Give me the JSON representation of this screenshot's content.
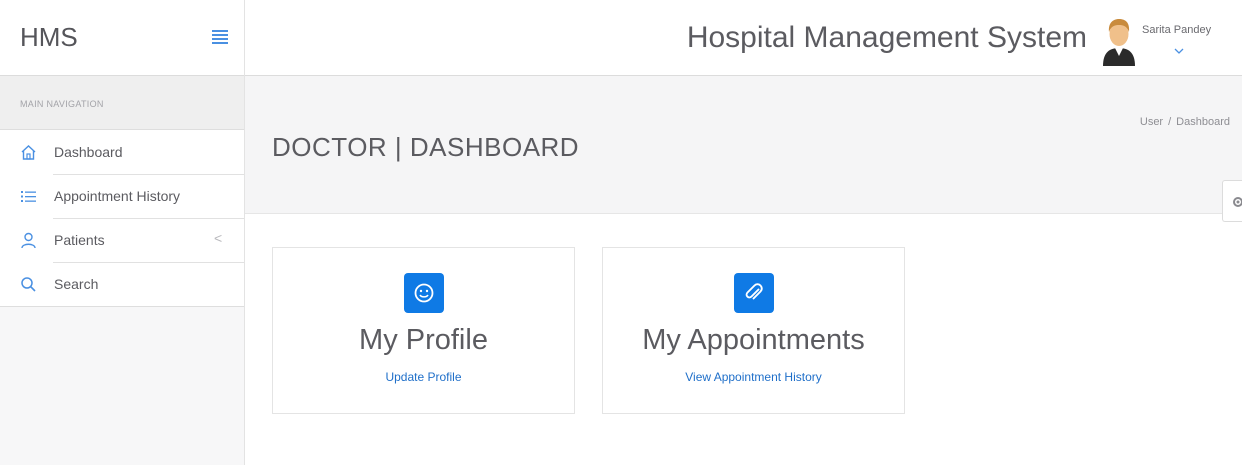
{
  "brand": "HMS",
  "sidebar": {
    "section_label": "MAIN NAVIGATION",
    "items": [
      {
        "label": "Dashboard",
        "icon": "home-icon"
      },
      {
        "label": "Appointment History",
        "icon": "list-icon"
      },
      {
        "label": "Patients",
        "icon": "user-icon",
        "chevron": "<"
      },
      {
        "label": "Search",
        "icon": "search-icon"
      }
    ]
  },
  "header": {
    "title": "Hospital Management System",
    "user_name": "Sarita Pandey"
  },
  "page": {
    "title": "DOCTOR | DASHBOARD",
    "breadcrumb": [
      "User",
      "Dashboard"
    ],
    "breadcrumb_sep": "/"
  },
  "cards": [
    {
      "title": "My Profile",
      "link": "Update Profile",
      "icon": "smiley-icon"
    },
    {
      "title": "My Appointments",
      "link": "View Appointment History",
      "icon": "paperclip-icon"
    }
  ],
  "colors": {
    "accent": "#0f7ae5",
    "link": "#1f6fc9",
    "menu_toggle": "#4a90e2"
  }
}
